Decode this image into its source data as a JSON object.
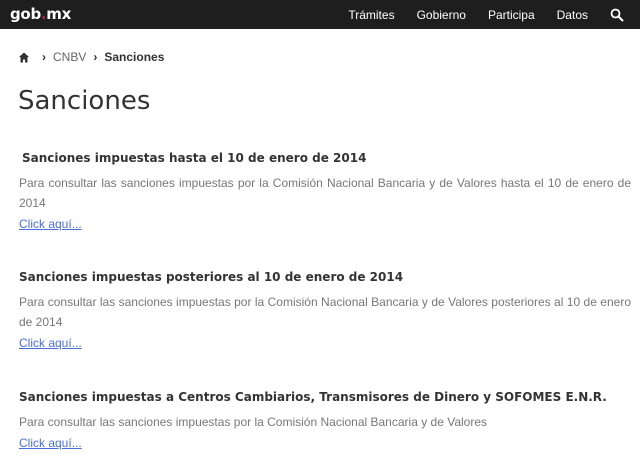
{
  "header": {
    "logo_main": "gob",
    "logo_dot": ".",
    "logo_tld": "mx",
    "nav": [
      "Trámites",
      "Gobierno",
      "Participa",
      "Datos"
    ],
    "search_icon": "search-icon"
  },
  "breadcrumb": {
    "home_icon": "home-icon",
    "parent": "CNBV",
    "current": "Sanciones"
  },
  "page": {
    "title": "Sanciones"
  },
  "sections": [
    {
      "title": "Sanciones impuestas hasta el 10 de enero de 2014",
      "text": "Para consultar las sanciones impuestas por la Comisión Nacional Bancaria y de Valores hasta el 10 de enero de 2014",
      "link": "Click aquí..."
    },
    {
      "title": "Sanciones impuestas posteriores al 10 de enero de 2014",
      "text": "Para consultar las sanciones impuestas por la Comisión Nacional Bancaria y de Valores posteriores al 10 de enero de 2014",
      "link": "Click aquí..."
    },
    {
      "title": "Sanciones impuestas a Centros Cambiarios, Transmisores de Dinero y SOFOMES E.N.R.",
      "text": "Para consultar las sanciones impuestas por la Comisión Nacional Bancaria y de Valores",
      "link": "Click aquí..."
    }
  ],
  "colors": {
    "navbar_bg": "#1e1e1e",
    "link": "#4a6fd6",
    "muted_text": "#777777"
  }
}
